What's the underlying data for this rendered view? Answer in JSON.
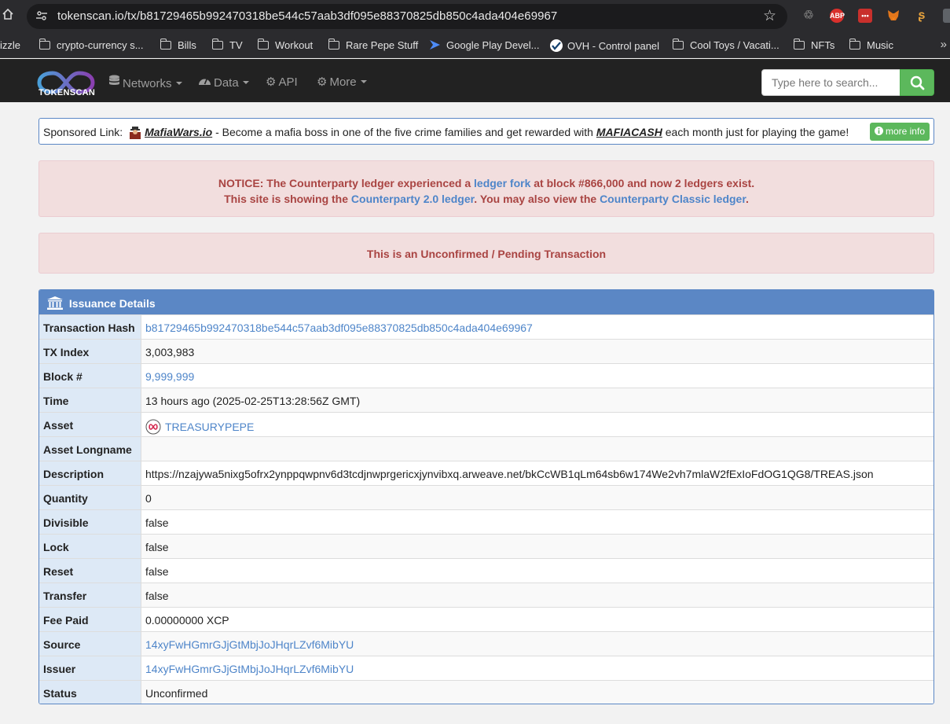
{
  "browser": {
    "url": "tokenscan.io/tx/b81729465b992470318be544c57aab3df095e88370825db850c4ada404e69967",
    "bookmarks": [
      {
        "label": "izzle",
        "icon": "none"
      },
      {
        "label": "crypto-currency s...",
        "icon": "folder-icon"
      },
      {
        "label": "Bills",
        "icon": "folder-icon"
      },
      {
        "label": "TV",
        "icon": "folder-icon"
      },
      {
        "label": "Workout",
        "icon": "folder-icon"
      },
      {
        "label": "Rare Pepe Stuff",
        "icon": "folder-icon"
      },
      {
        "label": "Google Play Devel...",
        "icon": "google-play-icon"
      },
      {
        "label": "OVH - Control panel",
        "icon": "ovh-icon"
      },
      {
        "label": "Cool Toys / Vacati...",
        "icon": "folder-icon"
      },
      {
        "label": "NFTs",
        "icon": "folder-icon"
      },
      {
        "label": "Music",
        "icon": "folder-icon"
      }
    ],
    "extensions": {
      "abp": "ABP",
      "dots": "•••"
    }
  },
  "navbar": {
    "logo_text": "TOKENSCAN",
    "networks": "Networks",
    "data": "Data",
    "api": "API",
    "more": "More",
    "search_placeholder": "Type here to search..."
  },
  "sponsored": {
    "prefix": "Sponsored Link:",
    "site": "MafiaWars.io",
    "middle": " - Become a mafia boss in one of the five crime families and get rewarded with ",
    "token": "MAFIACASH",
    "suffix": " each month just for playing the game!",
    "more_info": "more info"
  },
  "notice": {
    "line1_a": "NOTICE: The Counterparty ledger experienced a ",
    "line1_link": "ledger fork",
    "line1_b": " at block #866,000 and now 2 ledgers exist.",
    "line2_a": "This site is showing the ",
    "line2_link1": "Counterparty 2.0 ledger",
    "line2_b": ". You may also view the ",
    "line2_link2": "Counterparty Classic ledger",
    "line2_c": "."
  },
  "pending": "This is an Unconfirmed / Pending Transaction",
  "details": {
    "title": "Issuance Details",
    "rows": [
      {
        "key": "Transaction Hash",
        "value": "b81729465b992470318be544c57aab3df095e88370825db850c4ada404e69967",
        "link": true
      },
      {
        "key": "TX Index",
        "value": "3,003,983",
        "link": false
      },
      {
        "key": "Block #",
        "value": "9,999,999",
        "link": true
      },
      {
        "key": "Time",
        "value": "13 hours ago (2025-02-25T13:28:56Z GMT)",
        "link": false
      },
      {
        "key": "Asset",
        "value": "TREASURYPEPE",
        "link": true
      },
      {
        "key": "Asset Longname",
        "value": "",
        "link": false
      },
      {
        "key": "Description",
        "value": "https://nzajywa5nixg5ofrx2ynppqwpnv6d3tcdjnwprgericxjynvibxq.arweave.net/bkCcWB1qLm64sb6w174We2vh7mlaW2fExIoFdOG1QG8/TREAS.json",
        "link": false
      },
      {
        "key": "Quantity",
        "value": "0",
        "link": false
      },
      {
        "key": "Divisible",
        "value": "false",
        "link": false
      },
      {
        "key": "Lock",
        "value": "false",
        "link": false
      },
      {
        "key": "Reset",
        "value": "false",
        "link": false
      },
      {
        "key": "Transfer",
        "value": "false",
        "link": false
      },
      {
        "key": "Fee Paid",
        "value": "0.00000000 XCP",
        "link": false
      },
      {
        "key": "Source",
        "value": "14xyFwHGmrGJjGtMbjJoJHqrLZvf6MibYU",
        "link": true
      },
      {
        "key": "Issuer",
        "value": "14xyFwHGmrGJjGtMbjJoJHqrLZvf6MibYU",
        "link": true
      },
      {
        "key": "Status",
        "value": "Unconfirmed",
        "link": false
      }
    ]
  }
}
